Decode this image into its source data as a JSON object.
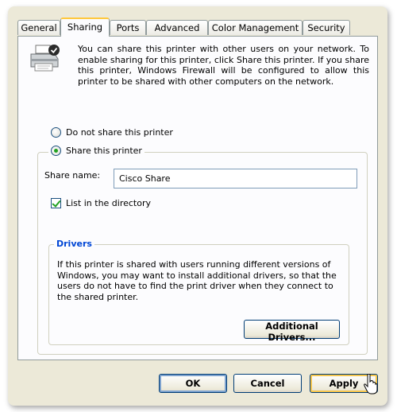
{
  "tabs": [
    {
      "label": "General",
      "active": false
    },
    {
      "label": "Sharing",
      "active": true
    },
    {
      "label": "Ports",
      "active": false
    },
    {
      "label": "Advanced",
      "active": false
    },
    {
      "label": "Color Management",
      "active": false
    },
    {
      "label": "Security",
      "active": false
    }
  ],
  "sharing": {
    "intro_text": "You can share this printer with other users on your network. To enable sharing for this printer, click Share this printer. If you share this printer, Windows Firewall will be configured to allow this printer to be shared with other computers on the network.",
    "option_no_share": "Do not share this printer",
    "option_share": "Share this printer",
    "selected_option": "share",
    "share_name_label": "Share name:",
    "share_name_value": "Cisco Share",
    "list_in_directory_label": "List in the directory",
    "list_in_directory_checked": true
  },
  "drivers": {
    "legend": "Drivers",
    "text": "If this printer is shared with users running different versions of Windows, you may want to install additional drivers, so that the users do not have to find the print driver when they connect to the shared printer.",
    "button": "Additional Drivers..."
  },
  "footer": {
    "ok": "OK",
    "cancel": "Cancel",
    "apply": "Apply"
  },
  "icons": {
    "printer": "printer-shared-icon",
    "cursor": "mouse-pointer-icon"
  },
  "colors": {
    "dialog_bg": "#ece9d8",
    "panel_bg": "#fcfcfe",
    "active_tab_accent": "#ffc83c",
    "drivers_legend": "#0046d5",
    "check_green": "#21a121"
  }
}
